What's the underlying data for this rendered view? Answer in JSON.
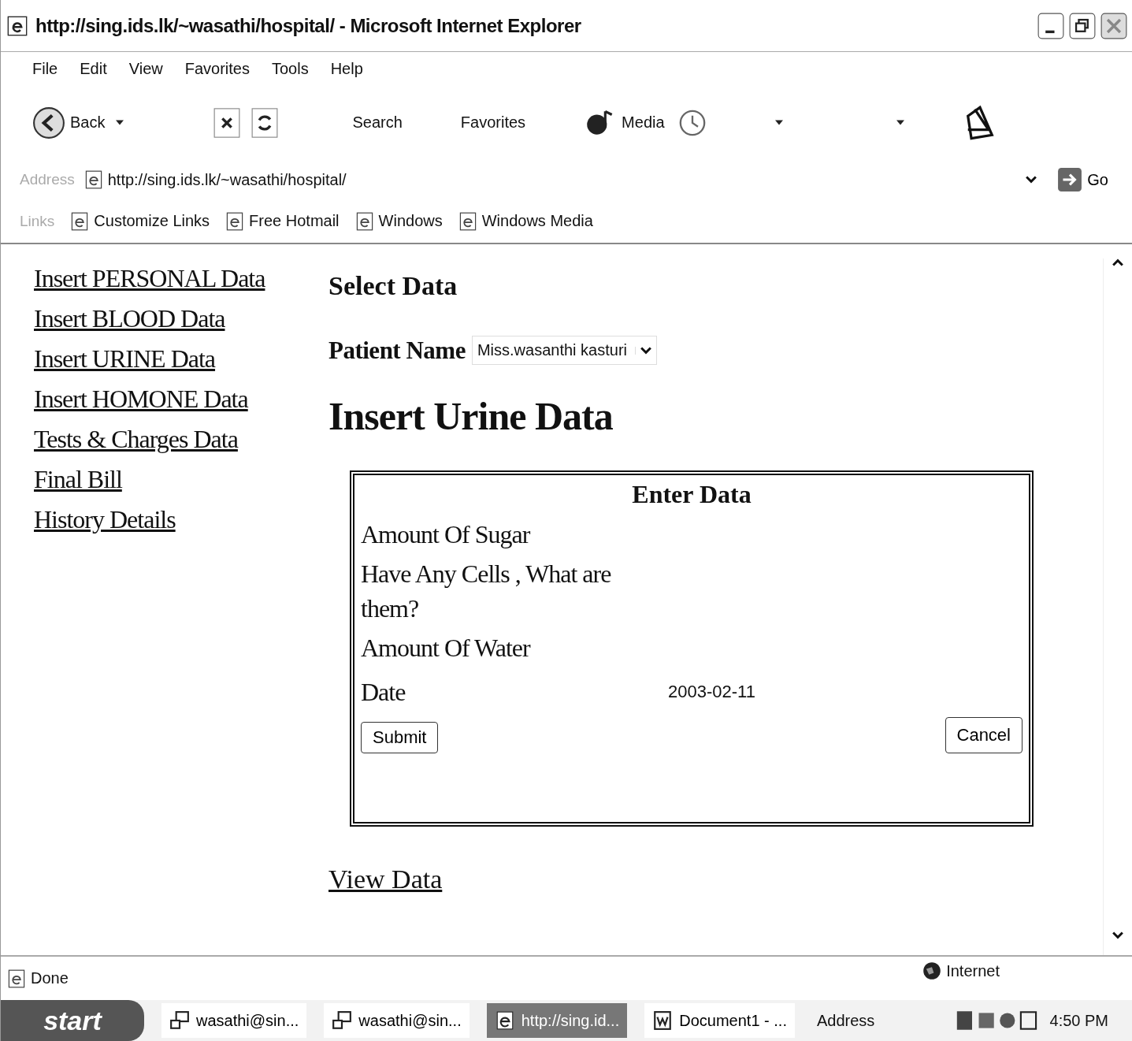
{
  "window": {
    "title": "http://sing.ids.lk/~wasathi/hospital/ - Microsoft Internet Explorer"
  },
  "menu": [
    "File",
    "Edit",
    "View",
    "Favorites",
    "Tools",
    "Help"
  ],
  "toolbar": {
    "back": "Back",
    "search": "Search",
    "favorites": "Favorites",
    "media": "Media"
  },
  "address_bar": {
    "label": "Address",
    "url": "http://sing.ids.lk/~wasathi/hospital/",
    "go": "Go"
  },
  "links_bar": {
    "label": "Links",
    "links": [
      "Customize Links",
      "Free Hotmail",
      "Windows",
      "Windows Media"
    ]
  },
  "sidebar": {
    "links": [
      "Insert PERSONAL Data",
      "Insert BLOOD Data",
      "Insert URINE Data",
      "Insert HOMONE Data",
      "Tests & Charges Data",
      "Final Bill",
      "History Details"
    ]
  },
  "main": {
    "select_heading": "Select Data",
    "patient_label": "Patient Name",
    "patient_value": "Miss.wasanthi kasturi",
    "heading": "Insert Urine Data",
    "form": {
      "title": "Enter Data",
      "fields": [
        {
          "label": "Amount Of Sugar"
        },
        {
          "label": "Have Any Cells , What are them?"
        },
        {
          "label": "Amount Of Water"
        },
        {
          "label": "Date",
          "value": "2003-02-11"
        }
      ],
      "submit": "Submit",
      "cancel": "Cancel"
    },
    "view_link": "View Data"
  },
  "status_bar": {
    "text": "Done",
    "zone": "Internet"
  },
  "taskbar": {
    "start": "start",
    "tasks": [
      {
        "label": "wasathi@sin...",
        "kind": "terminal",
        "selected": false
      },
      {
        "label": "wasathi@sin...",
        "kind": "terminal",
        "selected": false
      },
      {
        "label": "http://sing.id...",
        "kind": "browser",
        "selected": true
      },
      {
        "label": "Document1 - ...",
        "kind": "word",
        "selected": false
      }
    ],
    "address": "Address",
    "clock": "4:50 PM"
  }
}
